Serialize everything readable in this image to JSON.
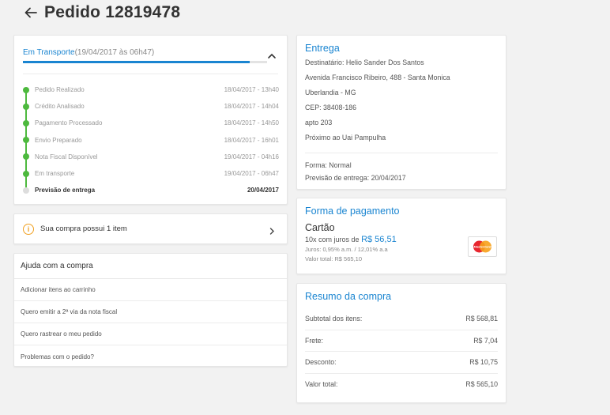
{
  "header": {
    "title": "Pedido 12819478",
    "back_icon": "arrow-left-icon"
  },
  "status": {
    "current_label": "Em Transporte",
    "current_date": "(19/04/2017 às 06h47)",
    "progress_fraction": 0.93,
    "steps": [
      {
        "label": "Pedido Realizado",
        "date": "18/04/2017 - 13h40"
      },
      {
        "label": "Crédito Analisado",
        "date": "18/04/2017 - 14h04"
      },
      {
        "label": "Pagamento Processado",
        "date": "18/04/2017 - 14h50"
      },
      {
        "label": "Envio Preparado",
        "date": "18/04/2017 - 16h01"
      },
      {
        "label": "Nota Fiscal Disponível",
        "date": "19/04/2017 - 04h16"
      },
      {
        "label": "Em transporte",
        "date": "19/04/2017 - 06h47"
      }
    ],
    "forecast": {
      "label": "Previsão de entrega",
      "date": "20/04/2017"
    }
  },
  "items": {
    "text": "Sua compra possui 1 item"
  },
  "help": {
    "title": "Ajuda com a compra",
    "items": [
      "Adicionar itens ao carrinho",
      "Quero emitir a 2ª via da nota fiscal",
      "Quero rastrear o meu pedido",
      "Problemas com o pedido?"
    ]
  },
  "entrega": {
    "title": "Entrega",
    "recipient": "Destinatário: Helio Sander Dos Santos",
    "address_lines": [
      "Avenida Francisco Ribeiro, 488 - Santa Monica",
      "Uberlandia - MG",
      "CEP: 38408-186",
      "apto 203",
      "Próximo ao Uai Pampulha"
    ],
    "forma": "Forma: Normal",
    "previsao": "Previsão de entrega: 20/04/2017"
  },
  "pagamento": {
    "title": "Forma de pagamento",
    "method": "Cartão",
    "installments_label": "10x com juros de",
    "installment_amount": "R$ 56,51",
    "juros": "Juros: 0,95% a.m. / 12,01% a.a",
    "valor_total": "Valor total: R$ 565,10",
    "card_logo": "mastercard-logo",
    "card_logo_text": "MasterCard"
  },
  "resumo": {
    "title": "Resumo da compra",
    "rows": [
      {
        "label": "Subtotal dos itens:",
        "value": "R$ 568,81"
      },
      {
        "label": "Frete:",
        "value": "R$ 7,04"
      },
      {
        "label": "Desconto:",
        "value": "R$ 10,75"
      },
      {
        "label": "Valor total:",
        "value": "R$ 565,10"
      }
    ]
  },
  "colors": {
    "accent": "#1a85d1",
    "success": "#4db93e",
    "warning": "#f0a020"
  }
}
